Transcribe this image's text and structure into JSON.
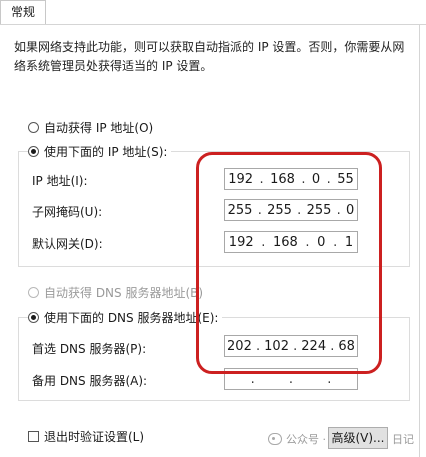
{
  "tab": {
    "label": "常规"
  },
  "description": "如果网络支持此功能，则可以获取自动指派的 IP 设置。否则，你需要从网络系统管理员处获得适当的 IP 设置。",
  "ip_section": {
    "auto_radio": "自动获得 IP 地址(O)",
    "manual_radio": "使用下面的 IP 地址(S):",
    "selected": "manual",
    "fields": [
      {
        "label": "IP 地址(I):",
        "octets": [
          "192",
          "168",
          "0",
          "55"
        ]
      },
      {
        "label": "子网掩码(U):",
        "octets": [
          "255",
          "255",
          "255",
          "0"
        ]
      },
      {
        "label": "默认网关(D):",
        "octets": [
          "192",
          "168",
          "0",
          "1"
        ]
      }
    ]
  },
  "dns_section": {
    "auto_radio": "自动获得 DNS 服务器地址(B)",
    "manual_radio": "使用下面的 DNS 服务器地址(E):",
    "selected": "manual",
    "fields": [
      {
        "label": "首选 DNS 服务器(P):",
        "octets": [
          "202",
          "102",
          "224",
          "68"
        ]
      },
      {
        "label": "备用 DNS 服务器(A):",
        "octets": [
          "",
          "",
          "",
          ""
        ]
      }
    ]
  },
  "validate_checkbox": {
    "label": "退出时验证设置(L)",
    "checked": false
  },
  "advanced_button": "高级(V)...",
  "watermark": {
    "text": "公众号 ·",
    "suffix": "日记"
  },
  "colors": {
    "highlight_ring": "#cc2020",
    "border": "#a8a8a8"
  }
}
